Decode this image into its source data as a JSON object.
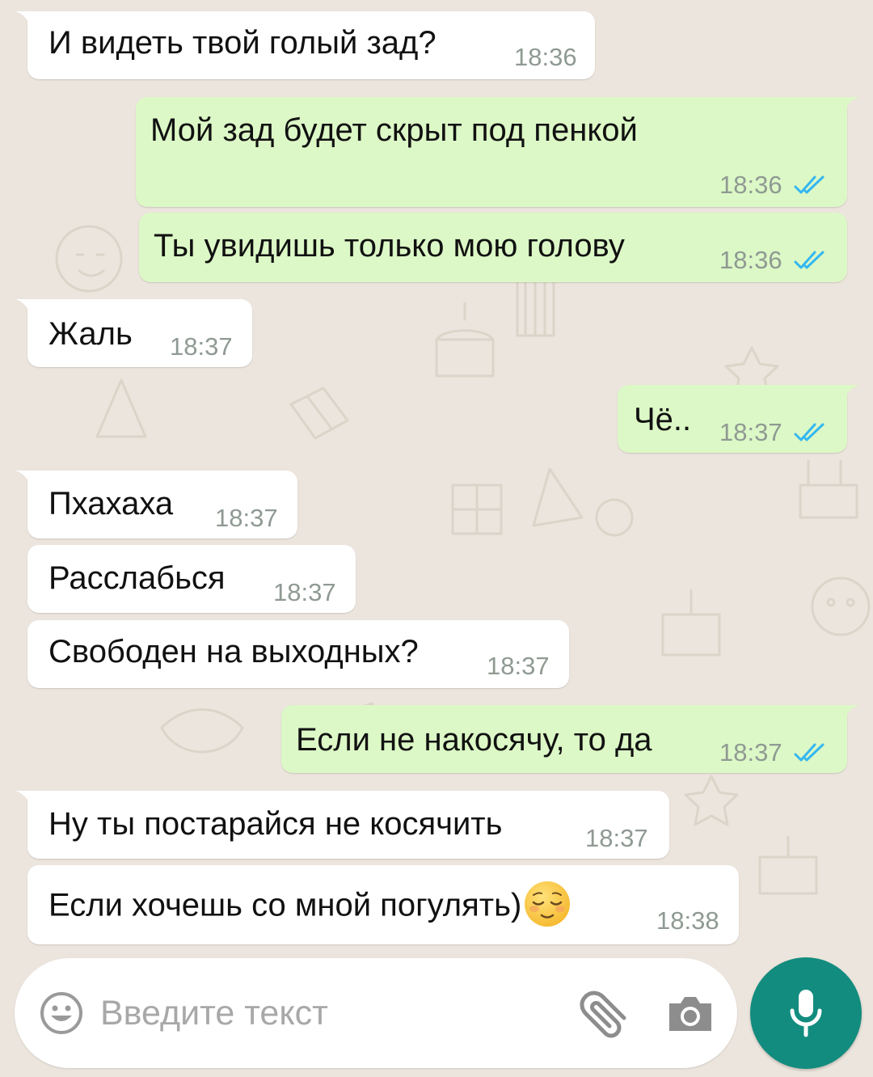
{
  "theme": {
    "background": "#ECE5DD",
    "incoming_bubble": "#FFFFFF",
    "outgoing_bubble": "#DCF8C6",
    "read_tick_color": "#34B7F1",
    "accent": "#128C7E"
  },
  "messages": [
    {
      "direction": "incoming",
      "text": "И видеть твой голый зад?",
      "time": "18:36",
      "tail": true
    },
    {
      "direction": "outgoing",
      "text": "Мой зад будет скрыт под пенкой",
      "time": "18:36",
      "status": "read",
      "tail": true
    },
    {
      "direction": "outgoing",
      "text": "Ты увидишь только мою голову",
      "time": "18:36",
      "status": "read",
      "tail": false
    },
    {
      "direction": "incoming",
      "text": "Жаль",
      "time": "18:37",
      "tail": true
    },
    {
      "direction": "outgoing",
      "text": "Чё..",
      "time": "18:37",
      "status": "read",
      "tail": true
    },
    {
      "direction": "incoming",
      "text": "Пхахаха",
      "time": "18:37",
      "tail": true
    },
    {
      "direction": "incoming",
      "text": "Расслабься",
      "time": "18:37",
      "tail": false
    },
    {
      "direction": "incoming",
      "text": "Свободен на выходных?",
      "time": "18:37",
      "tail": false
    },
    {
      "direction": "outgoing",
      "text": "Если не накосячу, то да",
      "time": "18:37",
      "status": "read",
      "tail": true
    },
    {
      "direction": "incoming",
      "text": "Ну ты постарайся не косячить",
      "time": "18:37",
      "tail": true
    },
    {
      "direction": "incoming",
      "text": "Если хочешь со мной погулять)",
      "emoji": "relieved-face",
      "time": "18:38",
      "tail": false
    }
  ],
  "composer": {
    "placeholder": "Введите текст",
    "emoji_icon": "smiley-icon",
    "attach_icon": "paperclip-icon",
    "camera_icon": "camera-icon",
    "mic_icon": "microphone-icon"
  }
}
